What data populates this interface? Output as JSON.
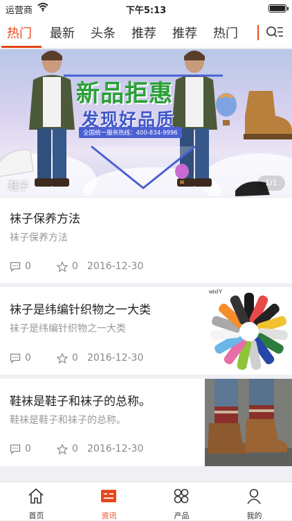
{
  "status_bar": {
    "carrier": "运营商",
    "time": "下午5:13"
  },
  "tabs": [
    {
      "label": "热门",
      "active": true
    },
    {
      "label": "最新"
    },
    {
      "label": "头条"
    },
    {
      "label": "推荐"
    },
    {
      "label": "推荐"
    },
    {
      "label": "热门"
    }
  ],
  "banner": {
    "headline": "新品拒惠",
    "tagline": "发现好品质",
    "hotline": "全国统一服务热线：400-834-9996",
    "label": "鞋子",
    "page_indicator": "1/1"
  },
  "articles": [
    {
      "title": "袜子保养方法",
      "summary": "袜子保养方法",
      "comments": "0",
      "likes": "0",
      "date": "2016-12-30",
      "thumbnail": null
    },
    {
      "title": "袜子是纬编针织物之一大类",
      "summary": "袜子是纬编针织物之一大类",
      "comments": "0",
      "likes": "0",
      "date": "2016-12-30",
      "thumbnail": "colorful-socks-fan",
      "thumbnail_caption": "wixIY"
    },
    {
      "title": "鞋袜是鞋子和袜子的总称。",
      "summary": "鞋袜是鞋子和袜子的总称。",
      "comments": "0",
      "likes": "0",
      "date": "2016-12-30",
      "thumbnail": "boots-and-socks"
    }
  ],
  "bottom_nav": [
    {
      "label": "首页",
      "icon": "home-icon"
    },
    {
      "label": "资讯",
      "icon": "news-icon",
      "active": true
    },
    {
      "label": "产品",
      "icon": "grid-icon"
    },
    {
      "label": "我的",
      "icon": "person-icon"
    }
  ],
  "colors": {
    "accent": "#e8471a",
    "background": "#efeff4"
  }
}
